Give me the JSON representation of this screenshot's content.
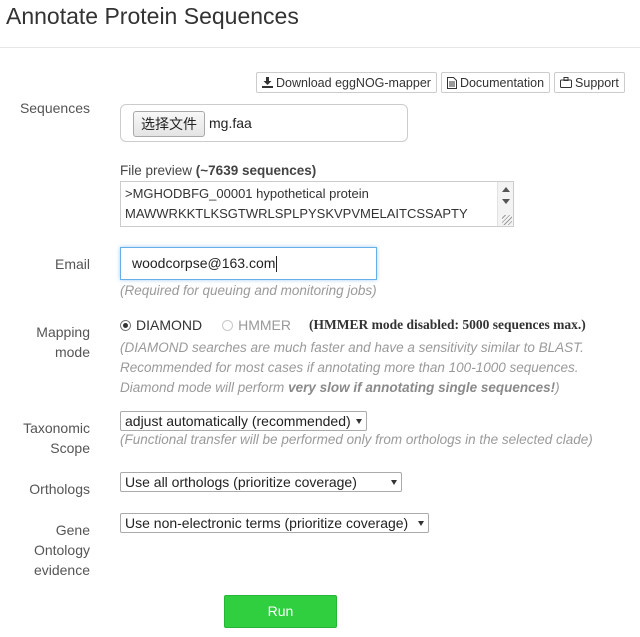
{
  "page": {
    "title": "Annotate Protein Sequences"
  },
  "toolbar": {
    "download_label": "Download eggNOG-mapper",
    "documentation_label": "Documentation",
    "support_label": "Support"
  },
  "sequences": {
    "label": "Sequences",
    "file_button": "选择文件",
    "file_name": "mg.faa",
    "preview_label": "File preview",
    "preview_count": "(~7639 sequences)",
    "preview_lines": [
      ">MGHODBFG_00001 hypothetical protein",
      "MAWWRKKTLKSGTWRLSPLPYSKVPVMELAITCSSAPTY"
    ]
  },
  "email": {
    "label": "Email",
    "value": "woodcorpse@163.com",
    "help": "(Required for queuing and monitoring jobs)"
  },
  "mapping": {
    "label_line1": "Mapping",
    "label_line2": "mode",
    "options": [
      {
        "label": "DIAMOND",
        "checked": true,
        "disabled": false
      },
      {
        "label": "HMMER",
        "checked": false,
        "disabled": true
      }
    ],
    "hmmer_note": "(HMMER mode disabled: 5000 sequences max.)",
    "help_line1": "(DIAMOND searches are much faster and have a sensitivity similar to BLAST.",
    "help_line2": "Recommended for most cases if annotating more than 100-1000 sequences.",
    "help_line3_pre": "Diamond mode will perform ",
    "help_line3_bold": "very slow if annotating single sequences!",
    "help_line3_post": ")"
  },
  "taxonomic": {
    "label_line1": "Taxonomic",
    "label_line2": "Scope",
    "selected": "adjust automatically (recommended)",
    "help": "(Functional transfer will be performed only from orthologs in the selected clade)"
  },
  "orthologs": {
    "label": "Orthologs",
    "selected": "Use all orthologs (prioritize coverage)"
  },
  "go": {
    "label_line1": "Gene",
    "label_line2": "Ontology",
    "label_line3": "evidence",
    "selected": "Use non-electronic terms (prioritize coverage)"
  },
  "run": {
    "label": "Run"
  },
  "colors": {
    "run_button": "#2fcf3f",
    "focus_border": "#66afe9",
    "help_text": "#9a9a9a"
  }
}
